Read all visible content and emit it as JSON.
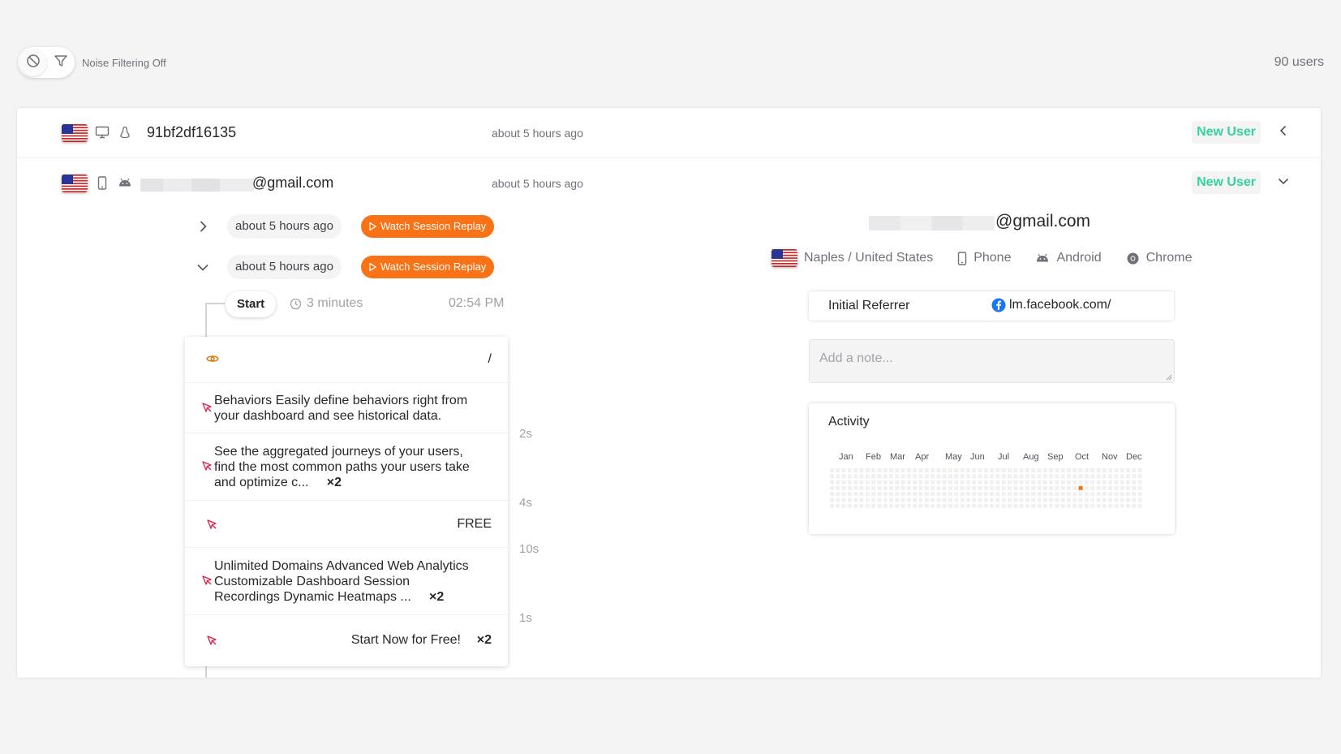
{
  "topbar": {
    "noise_filter_label": "Noise Filtering Off",
    "users_count": "90 users"
  },
  "rows": [
    {
      "user_id": "91bf2df16135",
      "time": "about 5 hours ago",
      "badge": "New User",
      "device": "desktop",
      "os": "linux"
    },
    {
      "email_suffix": "@gmail.com",
      "time": "about 5 hours ago",
      "badge": "New User",
      "device": "phone",
      "os": "android"
    }
  ],
  "sessions": [
    {
      "time": "about 5 hours ago",
      "watch_label": "Watch Session Replay",
      "expanded": false
    },
    {
      "time": "about 5 hours ago",
      "watch_label": "Watch Session Replay",
      "expanded": true
    }
  ],
  "timeline": {
    "start_label": "Start",
    "duration": "3 minutes",
    "start_time": "02:54 PM",
    "events": [
      {
        "type": "pageview",
        "path": "/"
      },
      {
        "type": "click",
        "text_line1": "Behaviors Easily define behaviors right from",
        "text_line2": "your dashboard and see historical data."
      },
      {
        "type": "click",
        "text_line1": "See the aggregated journeys of your users,",
        "text_line2": "find the most common paths your users take",
        "text_line3": "and optimize c...",
        "mult": "×2"
      },
      {
        "type": "click",
        "text": "FREE"
      },
      {
        "type": "click",
        "text_line1": "Unlimited Domains Advanced Web Analytics",
        "text_line2": "Customizable Dashboard Session",
        "text_line3": "Recordings Dynamic Heatmaps ...",
        "mult": "×2"
      },
      {
        "type": "click",
        "text": "Start Now for Free!",
        "mult": "×2"
      }
    ],
    "gaps": [
      "2s",
      "4s",
      "10s",
      "1s"
    ]
  },
  "profile": {
    "email_suffix": "@gmail.com",
    "location": "Naples / United States",
    "device": "Phone",
    "os": "Android",
    "browser": "Chrome",
    "referrer_label": "Initial Referrer",
    "referrer_value": "lm.facebook.com/",
    "note_placeholder": "Add a note...",
    "activity": {
      "title": "Activity",
      "months": [
        "Jan",
        "Feb",
        "Mar",
        "Apr",
        "May",
        "Jun",
        "Jul",
        "Aug",
        "Sep",
        "Oct",
        "Nov",
        "Dec"
      ],
      "active_color": "#f97316"
    }
  },
  "colors": {
    "accent": "#f97316",
    "new_user": "#34d399",
    "click_icon": "#e11d48",
    "pageview_icon": "#d97706"
  }
}
